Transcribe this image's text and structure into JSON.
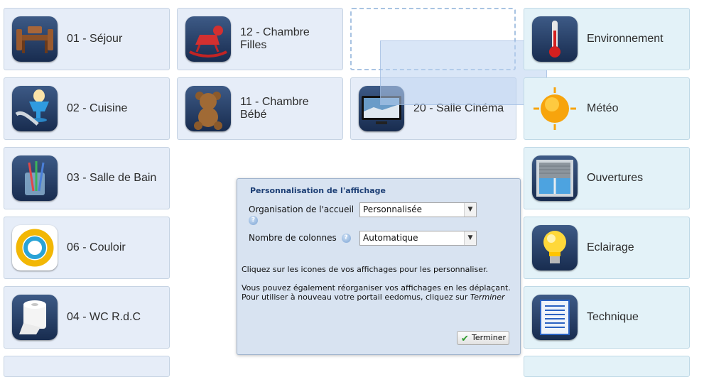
{
  "tiles": {
    "sejour": {
      "label": "01 - Séjour",
      "icon": "dining-table-icon"
    },
    "cuisine": {
      "label": "02 - Cuisine",
      "icon": "egg-cup-icon"
    },
    "sallebain": {
      "label": "03 - Salle de Bain",
      "icon": "toothbrush-icon"
    },
    "couloir": {
      "label": "06 - Couloir",
      "icon": "ring-icon"
    },
    "wc": {
      "label": "04 - WC R.d.C",
      "icon": "toilet-paper-icon"
    },
    "chambrefilles": {
      "label": "12 - Chambre Filles",
      "icon": "rocking-horse-icon"
    },
    "chambrebebe": {
      "label": "11 - Chambre Bébé",
      "icon": "teddy-bear-icon"
    },
    "cinema": {
      "label": "20 - Salle Cinéma",
      "icon": "tv-icon"
    },
    "environnement": {
      "label": "Environnement",
      "icon": "thermometer-icon"
    },
    "meteo": {
      "label": "Météo",
      "icon": "sun-icon"
    },
    "ouvertures": {
      "label": "Ouvertures",
      "icon": "shutter-window-icon"
    },
    "eclairage": {
      "label": "Eclairage",
      "icon": "light-bulb-icon"
    },
    "technique": {
      "label": "Technique",
      "icon": "document-list-icon"
    }
  },
  "panel": {
    "title": "Personnalisation de l'affichage",
    "org_label": "Organisation de l'accueil",
    "org_value": "Personnalisée",
    "cols_label": "Nombre de colonnes",
    "cols_value": "Automatique",
    "help_glyph": "?",
    "info_1": "Cliquez sur les icones de vos affichages pour les personnaliser.",
    "info_2": "Vous pouvez également réorganiser vos affichages en les déplaçant.",
    "info_3": "Pour utiliser à nouveau votre portail eedomus, cliquez sur",
    "info_3_em": "Terminer",
    "finish_label": "Terminer"
  }
}
